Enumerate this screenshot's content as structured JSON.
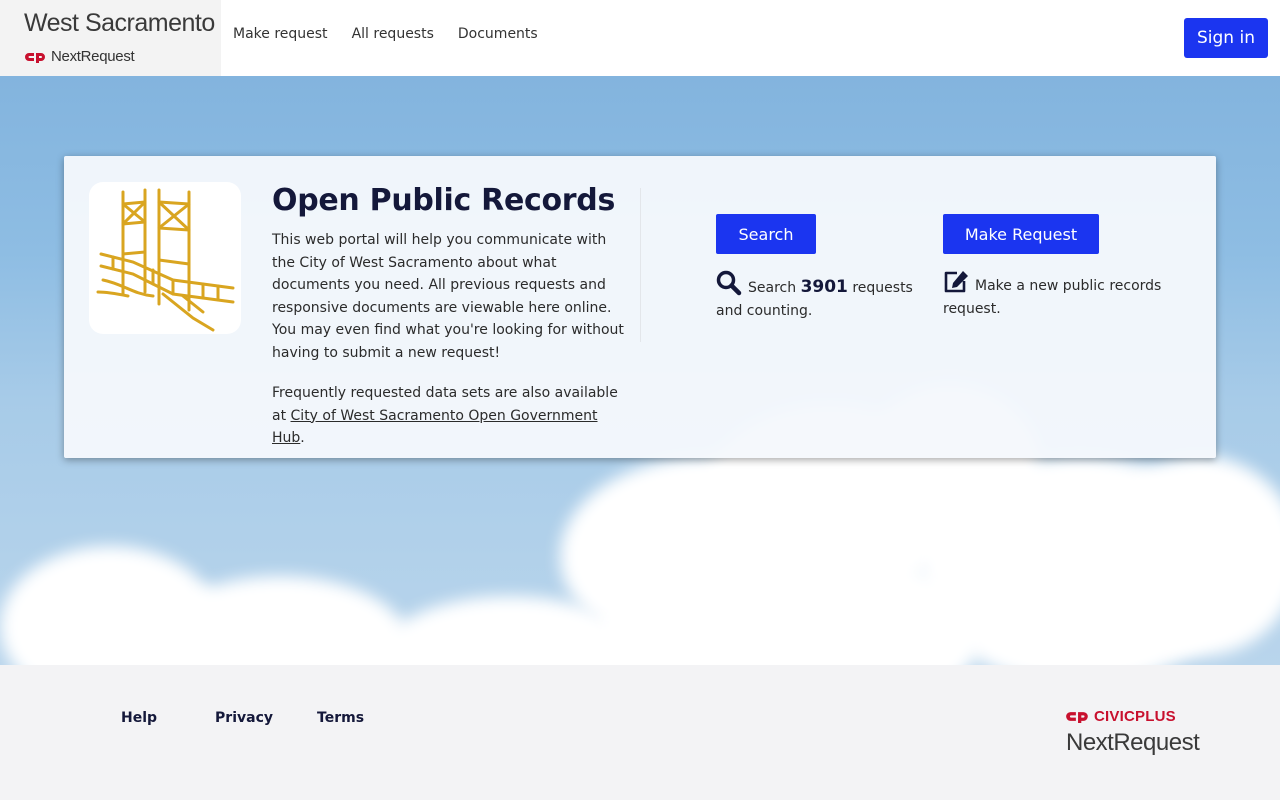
{
  "header": {
    "city_name": "West Sacramento",
    "product_name": "NextRequest",
    "nav": [
      "Make request",
      "All requests",
      "Documents"
    ],
    "signin_label": "Sign in"
  },
  "card": {
    "title": "Open Public Records",
    "body": "This web portal will help you communicate with the City of West Sacramento about what documents you need. All previous requests and responsive documents are viewable here online. You may even find what you're looking for without having to submit a new request!",
    "datasets_prefix": "Frequently requested data sets are also available at ",
    "datasets_link": "City of West Sacramento Open Government Hub",
    "datasets_suffix": "."
  },
  "actions": {
    "search": {
      "button": "Search",
      "desc_prefix": "Search ",
      "count": "3901",
      "desc_suffix": " requests and counting.",
      "icon": "search-icon"
    },
    "make_request": {
      "button": "Make Request",
      "desc": "Make a new public records request.",
      "icon": "edit-icon"
    }
  },
  "footer": {
    "links": [
      "Help",
      "Privacy",
      "Terms"
    ],
    "civicplus": "CIVICPLUS",
    "nextrequest": "NextRequest"
  },
  "colors": {
    "primary_button": "#1b35f0",
    "title": "#14183a",
    "brand_red": "#c8102e",
    "logo_gold": "#d9a520"
  }
}
